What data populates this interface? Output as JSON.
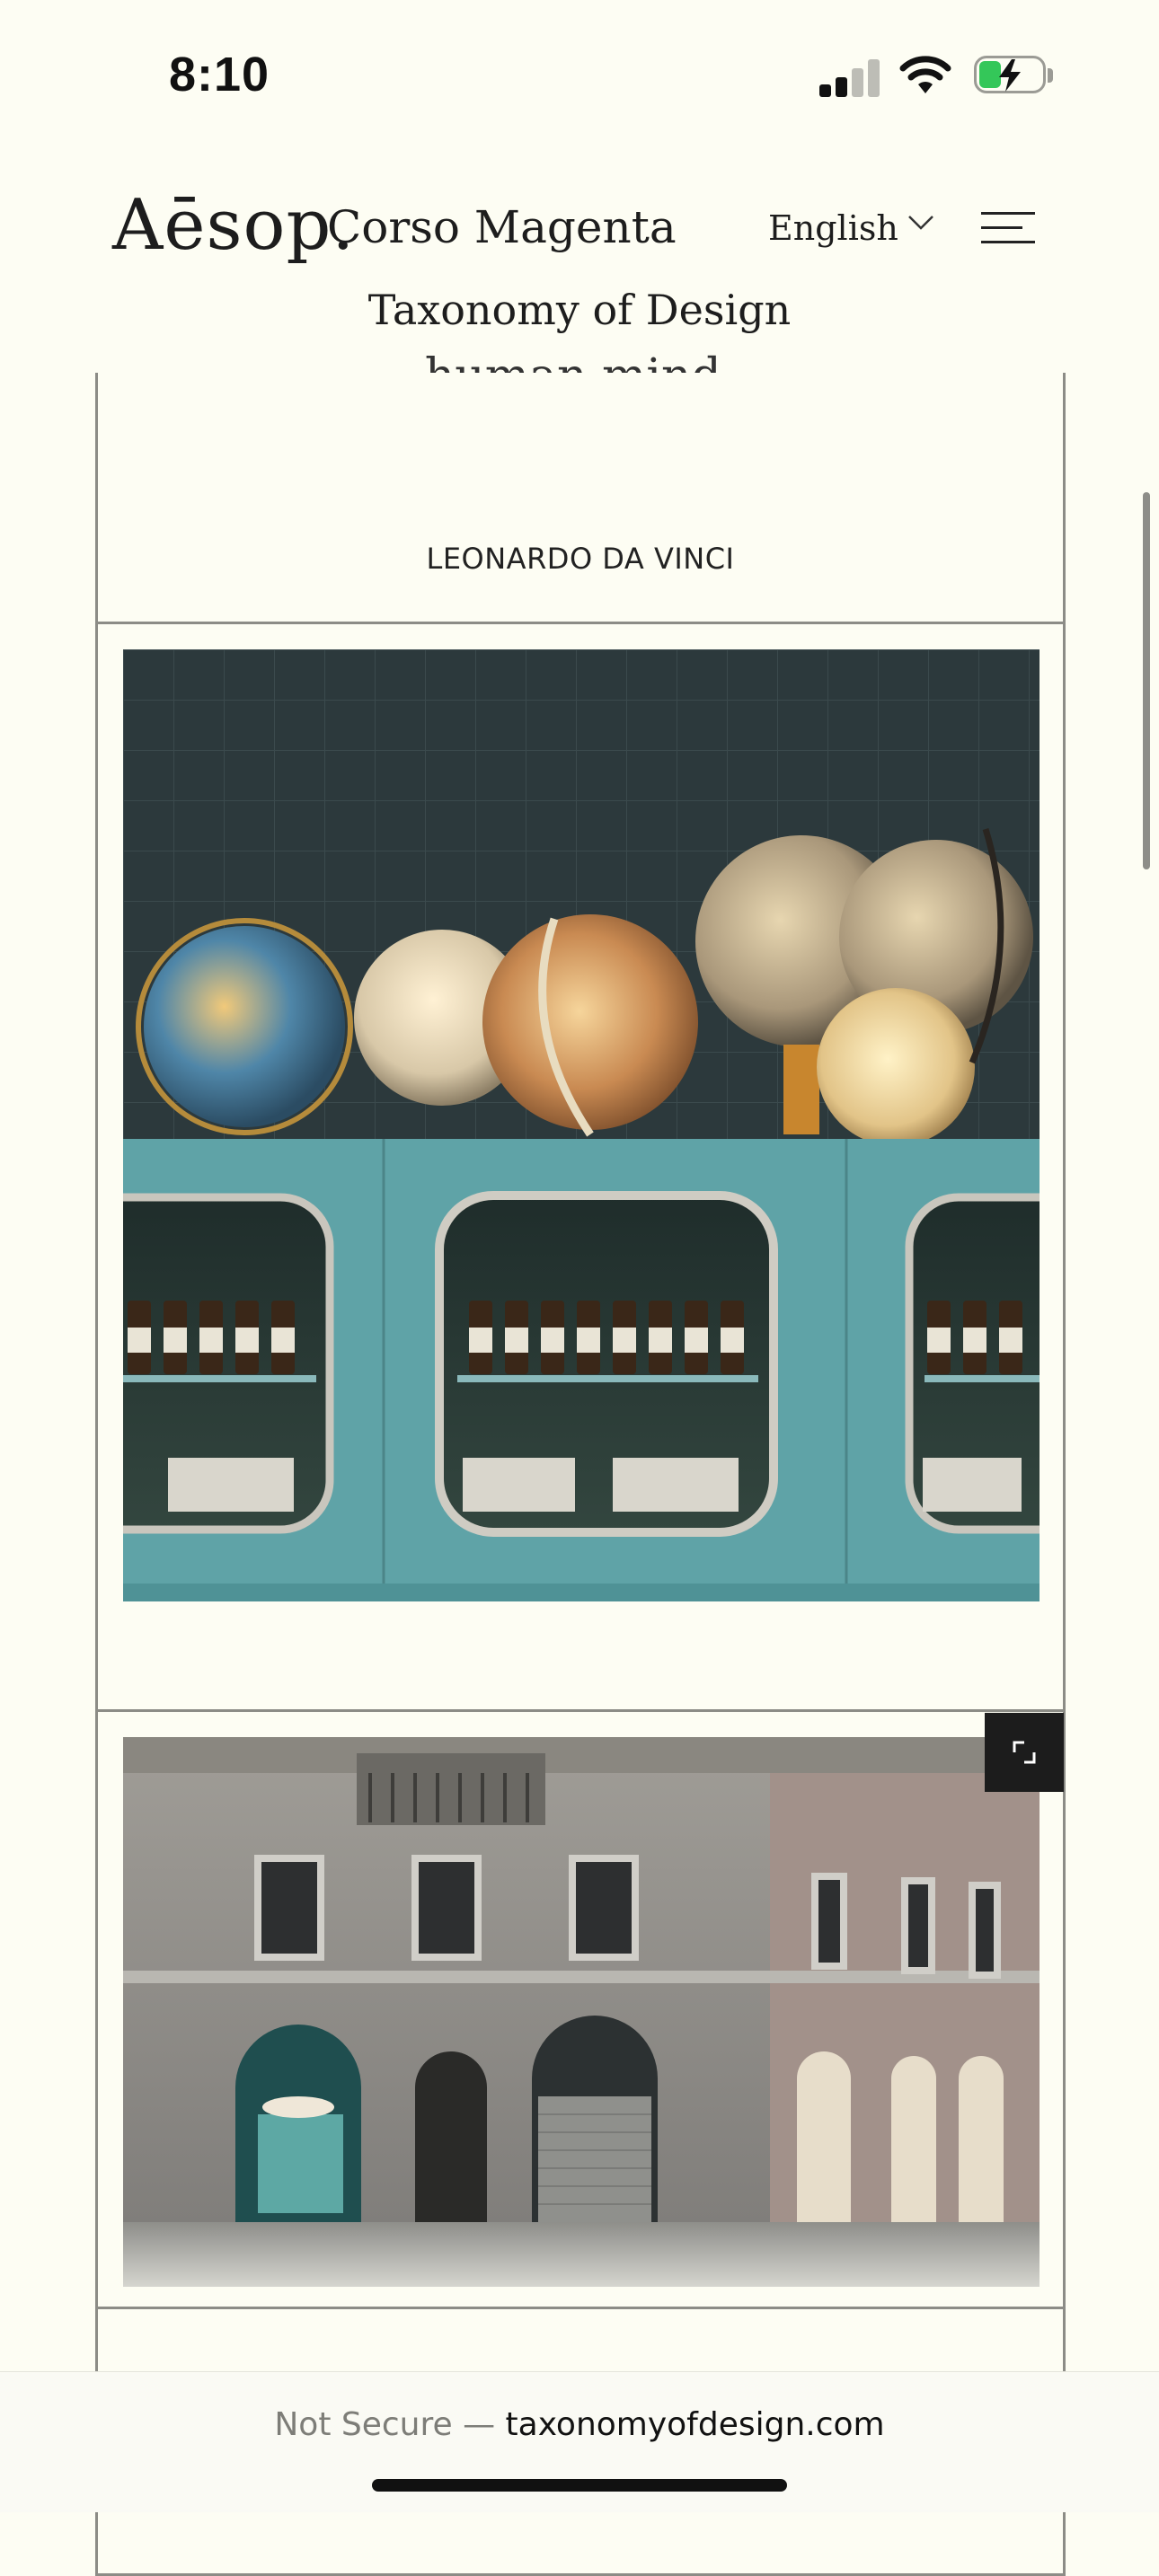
{
  "status_bar": {
    "time": "8:10"
  },
  "header": {
    "logo": "Aēsop.",
    "store_name": "Corso Magenta",
    "language": "English",
    "subtitle": "Taxonomy of Design"
  },
  "quote": {
    "text_fragment": "human mind.",
    "author": "LEONARDO DA VINCI"
  },
  "images": [
    {
      "name": "globes-and-teal-cabinets"
    },
    {
      "name": "store-facade-corner"
    }
  ],
  "browser": {
    "not_secure": "Not Secure —",
    "domain": "taxonomyofdesign.com"
  },
  "colors": {
    "background": "#fdfdf3",
    "teal_cabinet": "#5fa3a7",
    "tile_wall": "#2f3d40"
  }
}
